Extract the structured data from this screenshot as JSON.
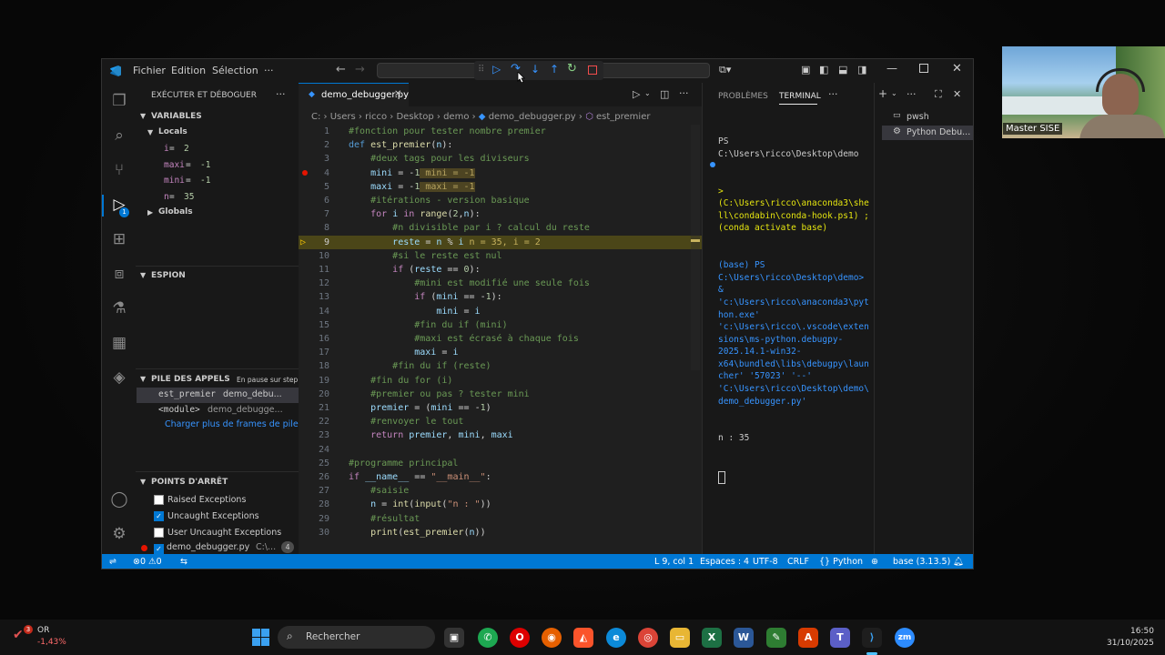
{
  "window": {
    "menu": [
      "Fichier",
      "Edition",
      "Sélection",
      "···"
    ],
    "debug_toolbar": [
      "continue",
      "step-over",
      "step-into",
      "step-out",
      "restart",
      "stop"
    ]
  },
  "sidebar": {
    "title": "EXÉCUTER ET DÉBOGUER",
    "variables_header": "VARIABLES",
    "locals_label": "Locals",
    "locals": [
      {
        "name": "i",
        "value": "2"
      },
      {
        "name": "maxi",
        "value": "-1"
      },
      {
        "name": "mini",
        "value": "-1"
      },
      {
        "name": "n",
        "value": "35"
      }
    ],
    "globals_label": "Globals",
    "watch_header": "ESPION",
    "callstack_header": "PILE DES APPELS",
    "callstack_status": "En pause sur step",
    "frames": [
      {
        "name": "est_premier",
        "file": "demo_debu..."
      },
      {
        "name": "<module>",
        "file": "demo_debugge..."
      }
    ],
    "load_more": "Charger plus de frames de pile",
    "breakpoints_header": "POINTS D'ARRÊT",
    "breakpoints": [
      {
        "label": "Raised Exceptions",
        "checked": false
      },
      {
        "label": "Uncaught Exceptions",
        "checked": true
      },
      {
        "label": "User Uncaught Exceptions",
        "checked": false
      }
    ],
    "breakpoint_file": {
      "label": "demo_debugger.py",
      "path": "C:\\...",
      "line": "4"
    }
  },
  "editor": {
    "tab_label": "demo_debugger.py",
    "breadcrumb": [
      "C:",
      "Users",
      "ricco",
      "Desktop",
      "demo",
      "demo_debugger.py",
      "est_premier"
    ],
    "current_line": 9,
    "lines": [
      {
        "n": "1",
        "t": "#fonction pour tester nombre premier"
      },
      {
        "n": "2",
        "t": "def est_premier(n):"
      },
      {
        "n": "3",
        "t": "    #deux tags pour les diviseurs"
      },
      {
        "n": "4",
        "t": "    mini = -1",
        "inline": "mini = -1"
      },
      {
        "n": "5",
        "t": "    maxi = -1",
        "inline": "maxi = -1"
      },
      {
        "n": "6",
        "t": "    #itérations - version basique"
      },
      {
        "n": "7",
        "t": "    for i in range(2,n):"
      },
      {
        "n": "8",
        "t": "        #n divisible par i ? calcul du reste"
      },
      {
        "n": "9",
        "t": "        reste = n % i",
        "inline": "n = 35, i = 2"
      },
      {
        "n": "10",
        "t": "        #si le reste est nul"
      },
      {
        "n": "11",
        "t": "        if (reste == 0):"
      },
      {
        "n": "12",
        "t": "            #mini est modifié une seule fois"
      },
      {
        "n": "13",
        "t": "            if (mini == -1):"
      },
      {
        "n": "14",
        "t": "                mini = i"
      },
      {
        "n": "15",
        "t": "            #fin du if (mini)"
      },
      {
        "n": "16",
        "t": "            #maxi est écrasé à chaque fois"
      },
      {
        "n": "17",
        "t": "            maxi = i"
      },
      {
        "n": "18",
        "t": "        #fin du if (reste)"
      },
      {
        "n": "19",
        "t": "    #fin du for (i)"
      },
      {
        "n": "20",
        "t": "    #premier ou pas ? tester mini"
      },
      {
        "n": "21",
        "t": "    premier = (mini == -1)"
      },
      {
        "n": "22",
        "t": "    #renvoyer le tout"
      },
      {
        "n": "23",
        "t": "    return premier, mini, maxi"
      },
      {
        "n": "24",
        "t": ""
      },
      {
        "n": "25",
        "t": "#programme principal"
      },
      {
        "n": "26",
        "t": "if __name__ == \"__main__\":"
      },
      {
        "n": "27",
        "t": "    #saisie"
      },
      {
        "n": "28",
        "t": "    n = int(input(\"n : \"))"
      },
      {
        "n": "29",
        "t": "    #résultat"
      },
      {
        "n": "30",
        "t": "    print(est_premier(n))"
      }
    ]
  },
  "panel": {
    "tab_problems": "PROBLÈMES",
    "tab_terminal": "TERMINAL",
    "terminals": [
      "pwsh",
      "Python Debu..."
    ],
    "lines": [
      {
        "text": "PS C:\\Users\\ricco\\Desktop\\demo",
        "color": "#cccccc"
      },
      {
        "text": "> (C:\\Users\\ricco\\anaconda3\\shell\\condabin\\conda-hook.ps1) ; (conda activate base)",
        "color": "#e5e510"
      },
      {
        "text": "(base) PS C:\\Users\\ricco\\Desktop\\demo>  & 'c:\\Users\\ricco\\anaconda3\\python.exe' 'c:\\Users\\ricco\\.vscode\\extensions\\ms-python.debugpy-2025.14.1-win32-x64\\bundled\\libs\\debugpy\\launcher' '57023' '--' 'C:\\Users\\ricco\\Desktop\\demo\\demo_debugger.py'",
        "color": "#3794ff"
      },
      {
        "text": "n : 35",
        "color": "#cccccc"
      }
    ]
  },
  "statusbar": {
    "errors": "0",
    "warnings": "0",
    "position": "L 9, col 1",
    "spaces": "Espaces : 4",
    "encoding": "UTF-8",
    "eol": "CRLF",
    "language": "Python",
    "env": "base (3.13.5)"
  },
  "webcam": {
    "name": "Master SISE"
  },
  "taskbar": {
    "stock_name": "OR",
    "stock_change": "-1,43%",
    "stock_badge": "3",
    "search_placeholder": "Rechercher",
    "time": "16:50",
    "date": "31/10/2025"
  }
}
